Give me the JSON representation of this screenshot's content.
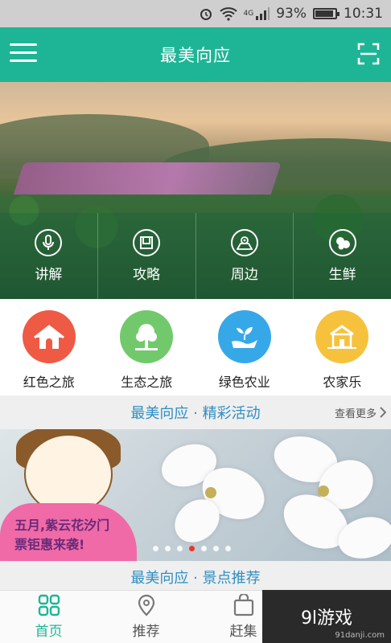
{
  "statusbar": {
    "battery": "93%",
    "time": "10:31",
    "network": "4G",
    "battery_level": 0.93
  },
  "header": {
    "title": "最美向应"
  },
  "hero": {
    "items": [
      {
        "label": "讲解",
        "icon": "microphone-icon"
      },
      {
        "label": "攻略",
        "icon": "guide-book-icon"
      },
      {
        "label": "周边",
        "icon": "map-location-icon"
      },
      {
        "label": "生鲜",
        "icon": "fresh-produce-icon"
      }
    ]
  },
  "categories": [
    {
      "label": "红色之旅",
      "color": "#ef5a45",
      "icon": "house-icon"
    },
    {
      "label": "生态之旅",
      "color": "#71c96b",
      "icon": "tree-icon"
    },
    {
      "label": "绿色农业",
      "color": "#36a8e8",
      "icon": "seedling-hand-icon"
    },
    {
      "label": "农家乐",
      "color": "#f6c23e",
      "icon": "farmhouse-icon"
    }
  ],
  "activities": {
    "title": "最美向应 · 精彩活动",
    "more": "查看更多"
  },
  "promo": {
    "line1": "五月,紫云花汐门",
    "line2": "票钜惠来袭!",
    "slide_count": 7,
    "active_slide": 4
  },
  "scenic": {
    "title": "最美向应 · 景点推荐"
  },
  "nav": [
    {
      "label": "首页",
      "icon": "grid-icon",
      "active": true
    },
    {
      "label": "推荐",
      "icon": "location-pin-icon",
      "active": false
    },
    {
      "label": "赶集",
      "icon": "shopping-bag-icon",
      "active": false
    }
  ],
  "watermark": {
    "brand": "9l游戏",
    "site": "91danji.com"
  },
  "colors": {
    "primary": "#1eb596",
    "section_title": "#2f8fc2"
  }
}
